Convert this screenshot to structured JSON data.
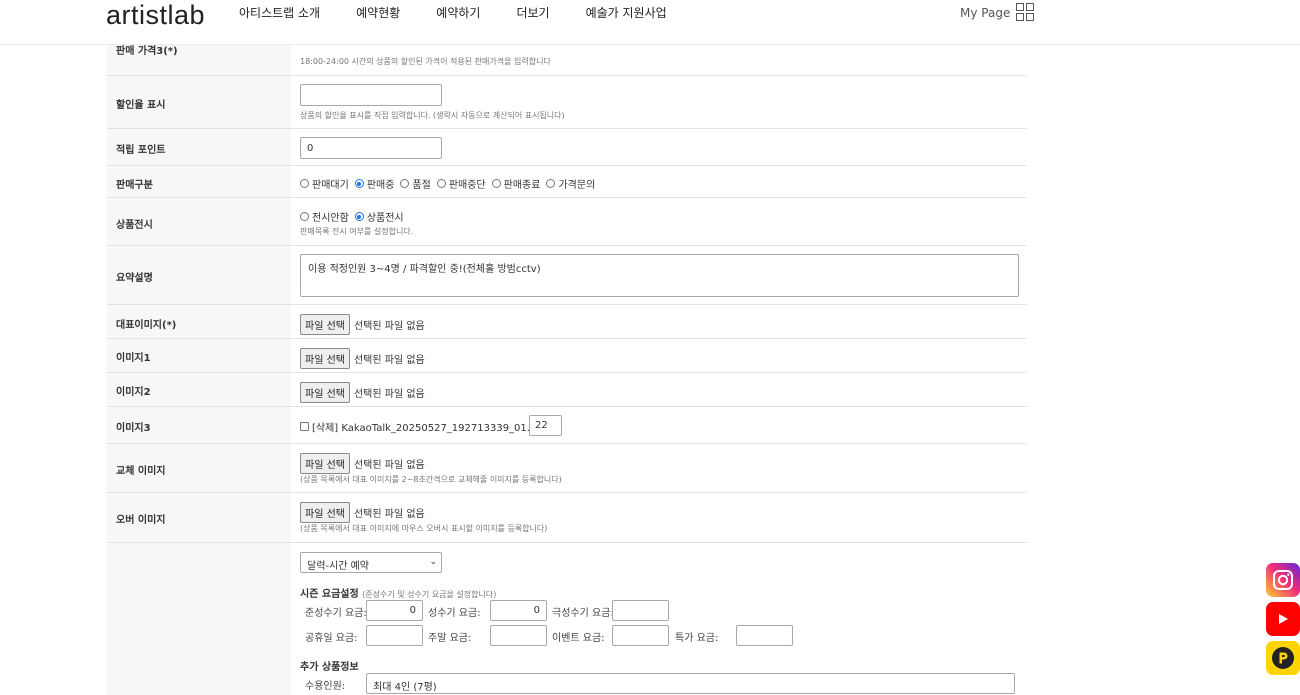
{
  "header": {
    "logo": "artistlab",
    "nav": [
      "아티스트랩 소개",
      "예약현황",
      "예약하기",
      "더보기",
      "예술가 지원사업"
    ],
    "mypage": "My Page"
  },
  "rows": {
    "price3": {
      "label": "판매 가격3(*)",
      "help": "18:00-24:00 시간의 상품의 할인된 가격이 적용된 판매가격을 입력합니다"
    },
    "discount": {
      "label": "할인율 표시",
      "value": "",
      "help": "상품의 할인율 표시를 직접 입력합니다. (생략시 자동으로 계산되어 표시됩니다)"
    },
    "points": {
      "label": "적립 포인트",
      "value": "0"
    },
    "sale_type": {
      "label": "판매구분",
      "options": [
        "판매대기",
        "판매중",
        "품절",
        "판매중단",
        "판매종료",
        "가격문의"
      ],
      "selected": "판매중"
    },
    "display": {
      "label": "상품전시",
      "options": [
        "전시안함",
        "상품전시"
      ],
      "selected": "상품전시",
      "help": "판매목록 전시 여부를 설정합니다."
    },
    "summary": {
      "label": "요약설명",
      "value": "이용 적정인원 3~4명 / 파격할인 중!(전체홀 방범cctv)"
    },
    "main_image": {
      "label": "대표이미지(*)"
    },
    "image1": {
      "label": "이미지1"
    },
    "image2": {
      "label": "이미지2"
    },
    "image3": {
      "label": "이미지3",
      "file": "[삭제] KakaoTalk_20250527_192713339_01.jpg",
      "order": "22"
    },
    "swap_image": {
      "label": "교체 이미지",
      "help": "(상품 목록에서 대표 이미지를 2~8초간격으로 교체해줄 이미지를 등록합니다)"
    },
    "over_image": {
      "label": "오버 이미지",
      "help": "(상품 목록에서 대표 이미지에 마우스 오버시 표시할 이미지를 등록합니다)"
    }
  },
  "file": {
    "button": "파일 선택",
    "none": "선택된 파일 없음"
  },
  "season": {
    "select": "달력-시간 예약",
    "title": "시즌 요금설정",
    "note": "(준성수기 및 성수기 요금을 설정합니다)",
    "semi_peak_label": "준성수기 요금:",
    "semi_peak": "0",
    "peak_label": "성수기 요금:",
    "peak": "0",
    "ultra_peak_label": "극성수기 요금:",
    "ultra_peak": "",
    "holiday_label": "공휴일 요금:",
    "holiday": "",
    "weekend_label": "주말 요금:",
    "weekend": "",
    "event_label": "이벤트 요금:",
    "event": "",
    "special_label": "특가 요금:",
    "special": ""
  },
  "extra": {
    "title": "추가 상품정보",
    "capacity_label": "수용인원:",
    "capacity": "최대 4인 (7평)"
  },
  "social": [
    "instagram-icon",
    "youtube-icon",
    "kakaopage-icon"
  ]
}
